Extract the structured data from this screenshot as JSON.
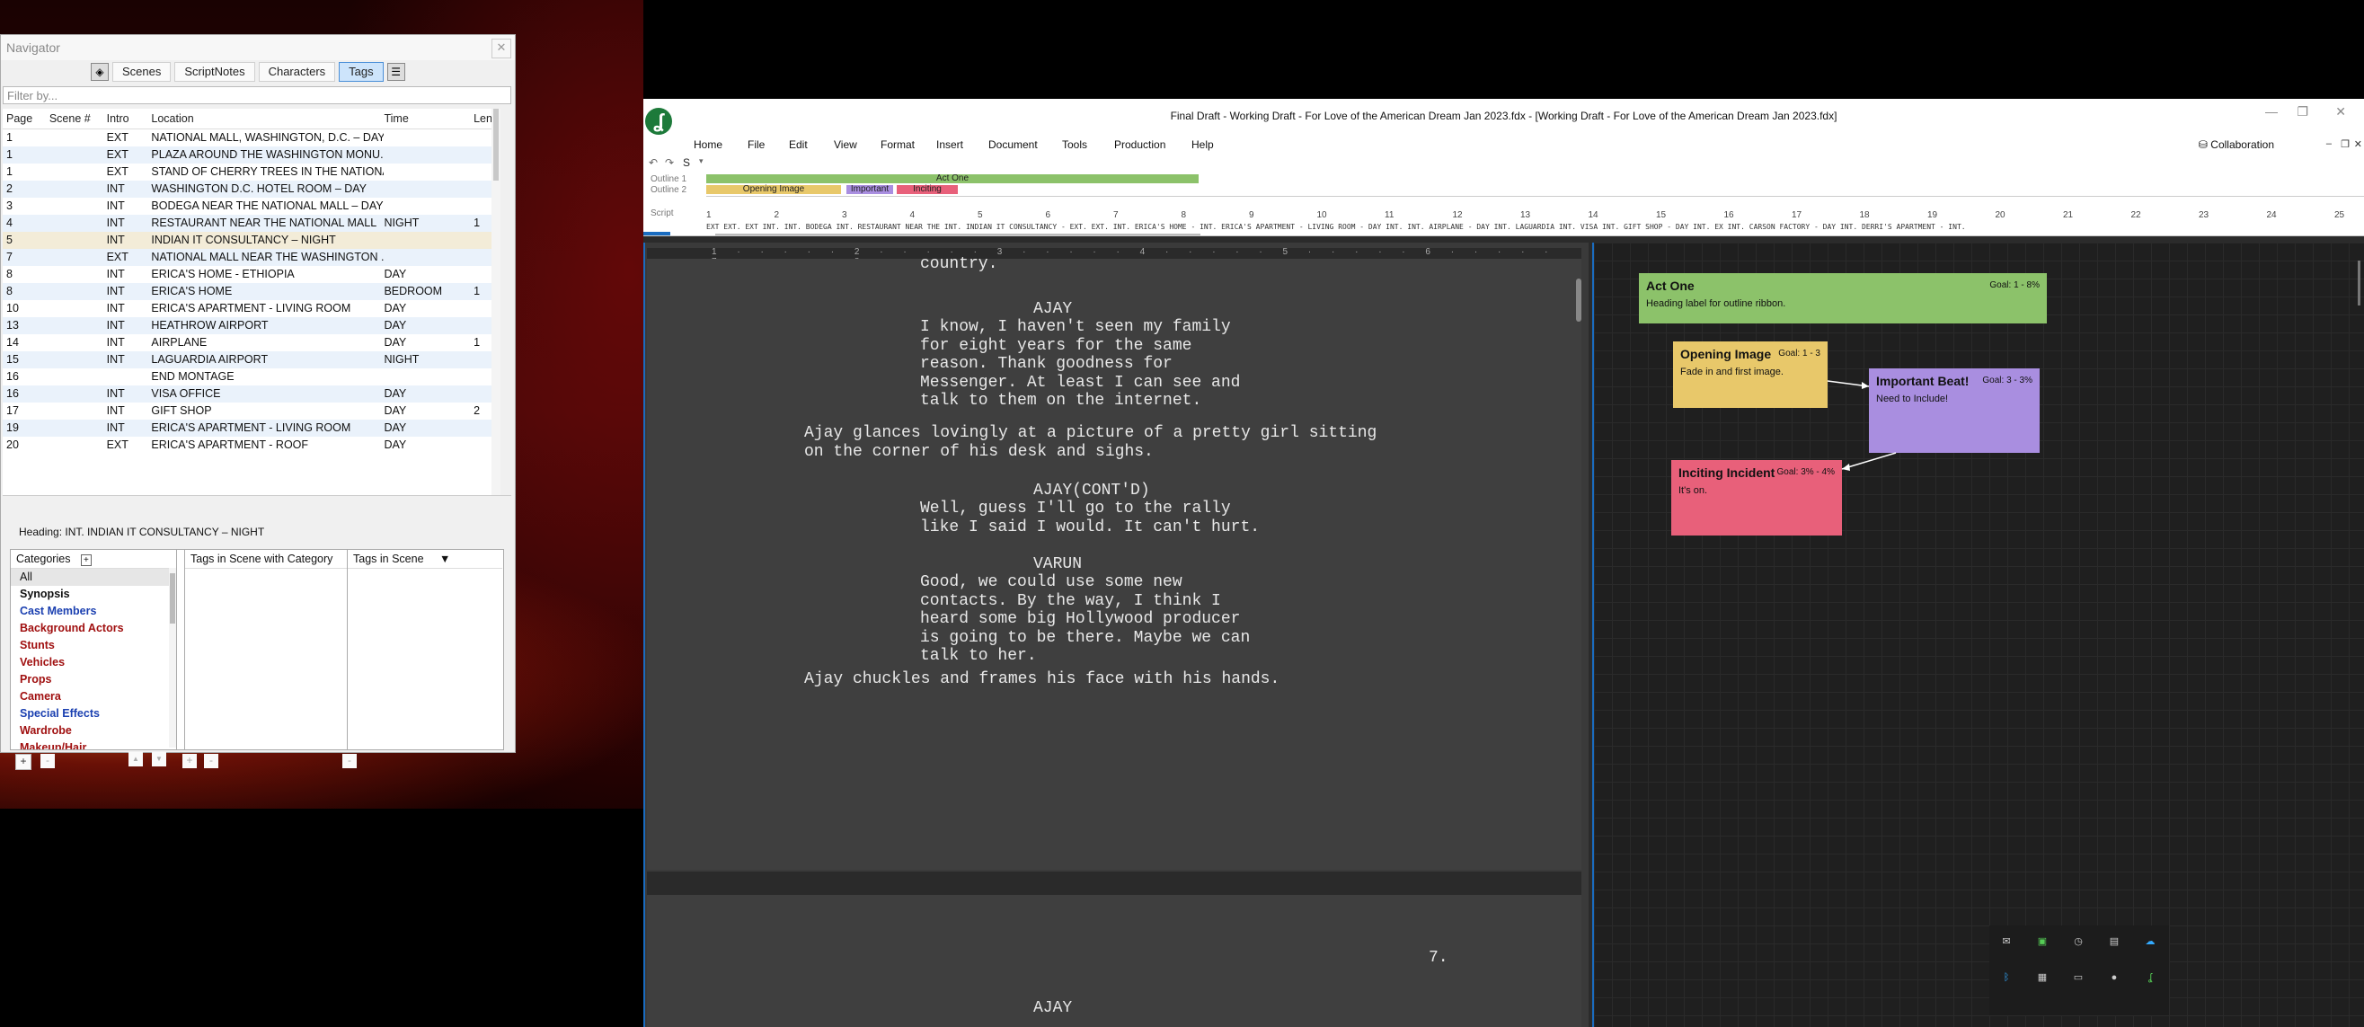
{
  "navigator": {
    "title": "Navigator",
    "tabs": [
      "Scenes",
      "ScriptNotes",
      "Characters",
      "Tags"
    ],
    "filter_placeholder": "Filter by...",
    "columns": [
      "Page",
      "Scene #",
      "Intro",
      "Location",
      "Time",
      "Len"
    ],
    "rows": [
      {
        "page": "1",
        "intro": "EXT",
        "loc": "NATIONAL MALL, WASHINGTON, D.C. – DAY",
        "time": "",
        "len": ""
      },
      {
        "page": "1",
        "intro": "EXT",
        "loc": "PLAZA AROUND THE WASHINGTON MONU...",
        "time": "",
        "len": ""
      },
      {
        "page": "1",
        "intro": "EXT",
        "loc": "STAND OF CHERRY TREES IN THE NATIONAL ...",
        "time": "",
        "len": ""
      },
      {
        "page": "2",
        "intro": "INT",
        "loc": "WASHINGTON D.C. HOTEL ROOM – DAY",
        "time": "",
        "len": ""
      },
      {
        "page": "3",
        "intro": "INT",
        "loc": "BODEGA NEAR THE NATIONAL MALL – DAY",
        "time": "",
        "len": ""
      },
      {
        "page": "4",
        "intro": "INT",
        "loc": "RESTAURANT NEAR THE NATIONAL MALL",
        "time": "NIGHT",
        "len": "1"
      },
      {
        "page": "5",
        "intro": "INT",
        "loc": "INDIAN IT CONSULTANCY – NIGHT",
        "time": "",
        "len": ""
      },
      {
        "page": "7",
        "intro": "EXT",
        "loc": "NATIONAL MALL NEAR THE WASHINGTON ...",
        "time": "",
        "len": ""
      },
      {
        "page": "8",
        "intro": "INT",
        "loc": "ERICA'S HOME - ETHIOPIA",
        "time": "DAY",
        "len": ""
      },
      {
        "page": "8",
        "intro": "INT",
        "loc": "ERICA'S HOME",
        "time": "BEDROOM",
        "len": "1"
      },
      {
        "page": "10",
        "intro": "INT",
        "loc": "ERICA'S APARTMENT - LIVING ROOM",
        "time": "DAY",
        "len": ""
      },
      {
        "page": "13",
        "intro": "INT",
        "loc": "HEATHROW AIRPORT",
        "time": "DAY",
        "len": ""
      },
      {
        "page": "14",
        "intro": "INT",
        "loc": "AIRPLANE",
        "time": "DAY",
        "len": "1"
      },
      {
        "page": "15",
        "intro": "INT",
        "loc": "LAGUARDIA AIRPORT",
        "time": "NIGHT",
        "len": ""
      },
      {
        "page": "16",
        "intro": "",
        "loc": "END MONTAGE",
        "time": "",
        "len": ""
      },
      {
        "page": "16",
        "intro": "INT",
        "loc": "VISA OFFICE",
        "time": "DAY",
        "len": ""
      },
      {
        "page": "17",
        "intro": "INT",
        "loc": "GIFT SHOP",
        "time": "DAY",
        "len": "2"
      },
      {
        "page": "19",
        "intro": "INT",
        "loc": "ERICA'S APARTMENT - LIVING ROOM",
        "time": "DAY",
        "len": ""
      },
      {
        "page": "20",
        "intro": "EXT",
        "loc": "ERICA'S APARTMENT - ROOF",
        "time": "DAY",
        "len": ""
      }
    ],
    "heading": "Heading:  INT. INDIAN IT CONSULTANCY – NIGHT",
    "categories_header": "Categories",
    "tags_with_category_header": "Tags in Scene with Category",
    "tags_in_scene_header": "Tags in Scene",
    "categories": [
      {
        "label": "All",
        "color": "#111111"
      },
      {
        "label": "Synopsis",
        "color": "#111111"
      },
      {
        "label": "Cast Members",
        "color": "#1a3fb0"
      },
      {
        "label": "Background Actors",
        "color": "#a01010"
      },
      {
        "label": "Stunts",
        "color": "#a01010"
      },
      {
        "label": "Vehicles",
        "color": "#a01010"
      },
      {
        "label": "Props",
        "color": "#a01010"
      },
      {
        "label": "Camera",
        "color": "#a01010"
      },
      {
        "label": "Special Effects",
        "color": "#1a3fb0"
      },
      {
        "label": "Wardrobe",
        "color": "#a01010"
      },
      {
        "label": "Makeup/Hair",
        "color": "#a01010"
      }
    ]
  },
  "app": {
    "title": "Final Draft - Working Draft - For Love of the American Dream Jan 2023.fdx - [Working Draft - For Love of the American Dream Jan 2023.fdx]",
    "menu": [
      "Home",
      "File",
      "Edit",
      "View",
      "Format",
      "Insert",
      "Document",
      "Tools",
      "Production",
      "Help"
    ],
    "collaboration": "Collaboration",
    "outline1_label": "Outline 1",
    "outline2_label": "Outline 2",
    "script_label": "Script",
    "outline1_bar": "Act One",
    "outline2_bars": [
      "Opening Image",
      "Important",
      "Inciting"
    ],
    "ruler_numbers": [
      "1",
      "2",
      "3",
      "4",
      "5",
      "6",
      "7",
      "8",
      "9",
      "10",
      "11",
      "12",
      "13",
      "14",
      "15",
      "16",
      "17",
      "18",
      "19",
      "20",
      "21",
      "22",
      "23",
      "24",
      "25"
    ],
    "scene_strip": "EXT EXT.    EXT  INT.      INT. BODEGA    INT. RESTAURANT NEAR THE  INT. INDIAN IT CONSULTANCY - EXT.  EXT.      INT. ERICA'S HOME -      INT. ERICA'S APARTMENT - LIVING ROOM - DAY   INT.       INT. AIRPLANE - DAY   INT. LAGUARDIA  INT. VISA        INT. GIFT SHOP - DAY           INT.       EX   INT. CARSON FACTORY - DAY       INT. DERRI'S APARTMENT -    INT."
  },
  "script": {
    "line_country": "country.",
    "char1": "AJAY",
    "dialog1": "I know, I haven't seen my family\nfor eight years for the same\nreason. Thank goodness for\nMessenger. At least I can see and\ntalk to them on the internet.",
    "action1": "Ajay glances lovingly at a picture of a pretty girl sitting\non the corner of his desk and sighs.",
    "char2": "AJAY(CONT'D)",
    "dialog2": "Well, guess I'll go to the rally\nlike I said I would. It can't hurt.",
    "char3": "VARUN",
    "dialog3": "Good, we could use some new\ncontacts. By the way, I think I\nheard some big Hollywood producer\nis going to be there. Maybe we can\ntalk to her.",
    "action2": "Ajay chuckles and frames his face with his hands.",
    "page_num": "7.",
    "char4": "AJAY"
  },
  "beats": [
    {
      "id": "act-one",
      "title": "Act One",
      "goal": "Goal: 1 - 8%",
      "body": "Heading label for outline ribbon.",
      "color": "#8cc26a"
    },
    {
      "id": "opening-image",
      "title": "Opening Image",
      "goal": "Goal: 1 - 3",
      "body": "Fade in and first image.",
      "color": "#e8c86a"
    },
    {
      "id": "important-beat",
      "title": "Important Beat!",
      "goal": "Goal: 3 - 3%",
      "body": "Need to Include!",
      "color": "#a98ee0"
    },
    {
      "id": "inciting-incident",
      "title": "Inciting Incident",
      "goal": "Goal: 3% - 4%",
      "body": "It's on.",
      "color": "#e8607a"
    }
  ]
}
